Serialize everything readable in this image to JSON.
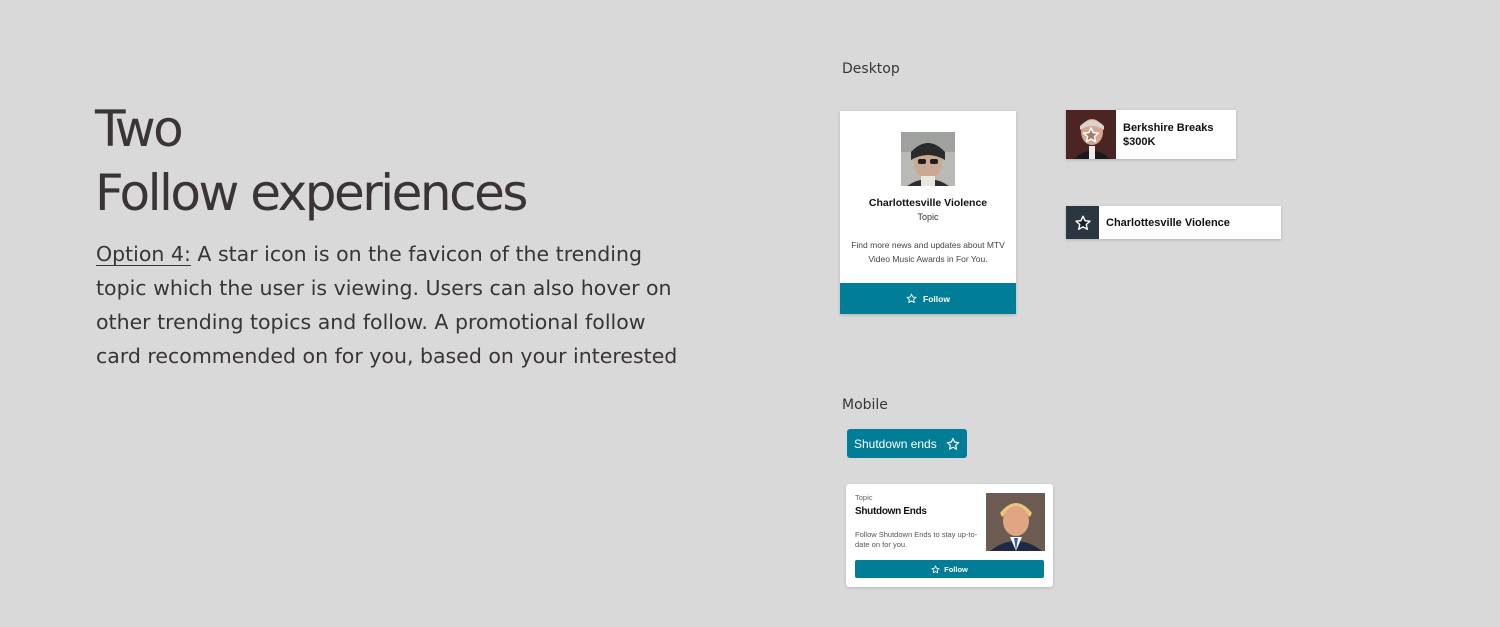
{
  "headline": {
    "line1": "Two",
    "line2": "Follow experiences"
  },
  "description": {
    "option_label": "Option 4:",
    "text": " A star icon is on the favicon of the trending topic which the user is viewing. Users can also hover on other trending topics and follow. A promotional follow card recommended on for you, based on your interested"
  },
  "desktop": {
    "label": "Desktop",
    "follow_card": {
      "title": "Charlottesville Violence",
      "subtitle": "Topic",
      "description": "Find more news and updates about MTV Video Music Awards in For You.",
      "follow_label": "Follow",
      "icon": "star-outline-icon"
    },
    "trending_chips": [
      {
        "label_line1": "Berkshire Breaks",
        "label_line2": "$300K",
        "icon": "star-outline-icon"
      },
      {
        "label": "Charlottesville Violence",
        "icon": "star-filled-icon"
      }
    ]
  },
  "mobile": {
    "label": "Mobile",
    "pill": {
      "label": "Shutdown ends",
      "icon": "star-outline-icon"
    },
    "card": {
      "topic": "Topic",
      "title": "Shutdown Ends",
      "description": "Follow Shutdown Ends to stay up-to-date on for you.",
      "follow_label": "Follow",
      "icon": "star-outline-icon"
    }
  },
  "colors": {
    "background": "#d9d9d9",
    "accent": "#017d98",
    "text": "#3a3435"
  }
}
